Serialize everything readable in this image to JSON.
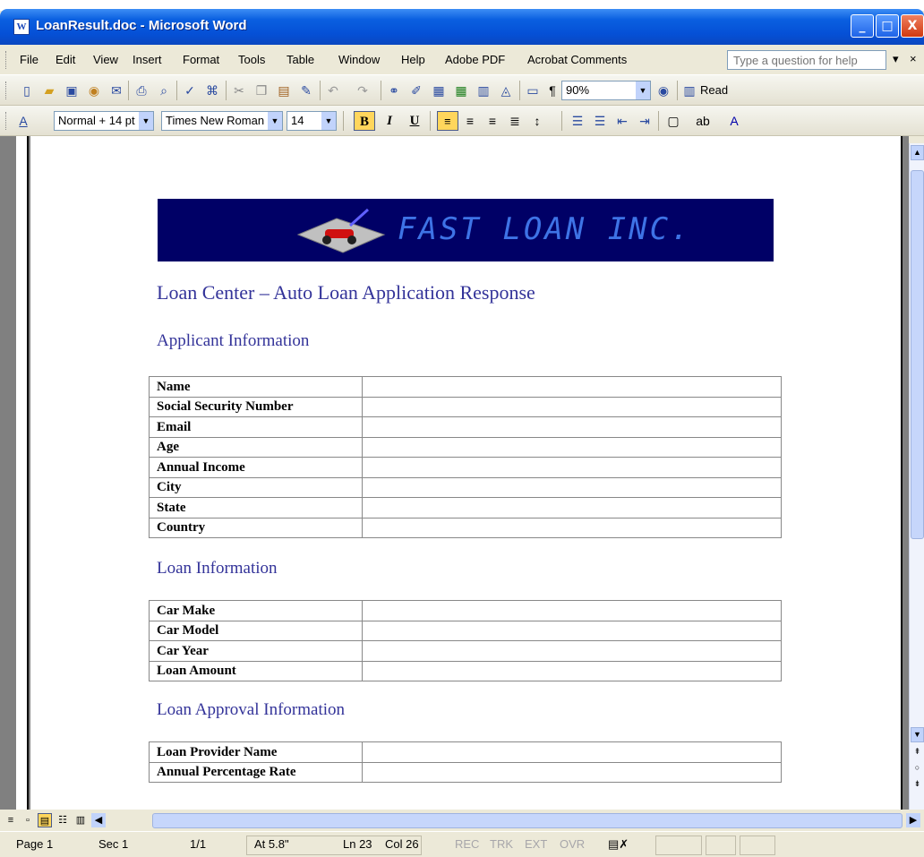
{
  "window": {
    "title": "LoanResult.doc - Microsoft Word",
    "app_icon": "W",
    "minimize_label": "_",
    "maximize_label": "□",
    "close_label": "X"
  },
  "menu": {
    "items": [
      "File",
      "Edit",
      "View",
      "Insert",
      "Format",
      "Tools",
      "Table",
      "Window",
      "Help",
      "Adobe PDF",
      "Acrobat Comments"
    ],
    "help_placeholder": "Type a question for help",
    "close_doc": "×"
  },
  "standard_toolbar": {
    "icons": [
      "new-icon",
      "open-icon",
      "save-icon",
      "permission-icon",
      "email-icon",
      "print-icon",
      "print-preview-icon",
      "spelling-icon",
      "research-icon",
      "cut-icon",
      "copy-icon",
      "paste-icon",
      "format-painter-icon",
      "undo-icon",
      "redo-icon",
      "hyperlink-icon",
      "tables-borders-icon",
      "insert-table-icon",
      "insert-excel-icon",
      "columns-icon",
      "drawing-icon",
      "document-map-icon",
      "show-hide-icon"
    ],
    "zoom": "90%",
    "read_label": "Read"
  },
  "formatting_toolbar": {
    "style": "Normal + 14 pt",
    "font": "Times New Roman",
    "size": "14",
    "bold": "B",
    "italic": "I",
    "underline": "U"
  },
  "document": {
    "banner_text": "FAST LOAN INC.",
    "heading": "Loan Center – Auto Loan Application Response",
    "sections": [
      {
        "title": "Applicant Information",
        "rows": [
          {
            "label": "Name",
            "value": ""
          },
          {
            "label": "Social Security Number",
            "value": ""
          },
          {
            "label": "Email",
            "value": ""
          },
          {
            "label": "Age",
            "value": ""
          },
          {
            "label": "Annual Income",
            "value": ""
          },
          {
            "label": "City",
            "value": ""
          },
          {
            "label": "State",
            "value": ""
          },
          {
            "label": "Country",
            "value": ""
          }
        ]
      },
      {
        "title": "Loan Information",
        "rows": [
          {
            "label": "Car Make",
            "value": ""
          },
          {
            "label": "Car Model",
            "value": ""
          },
          {
            "label": "Car Year",
            "value": ""
          },
          {
            "label": "Loan Amount",
            "value": ""
          }
        ]
      },
      {
        "title": "Loan Approval Information",
        "rows": [
          {
            "label": "Loan Provider Name",
            "value": ""
          },
          {
            "label": "Annual Percentage Rate",
            "value": ""
          }
        ]
      }
    ]
  },
  "status": {
    "page": "Page 1",
    "sec": "Sec 1",
    "pages": "1/1",
    "at": "At 5.8\"",
    "ln": "Ln 23",
    "col": "Col 26",
    "rec": "REC",
    "trk": "TRK",
    "ext": "EXT",
    "ovr": "OVR"
  },
  "colors": {
    "heading": "#333399",
    "banner_bg": "#000066",
    "banner_text": "#3e73e6",
    "titlebar": "#0550d6"
  }
}
